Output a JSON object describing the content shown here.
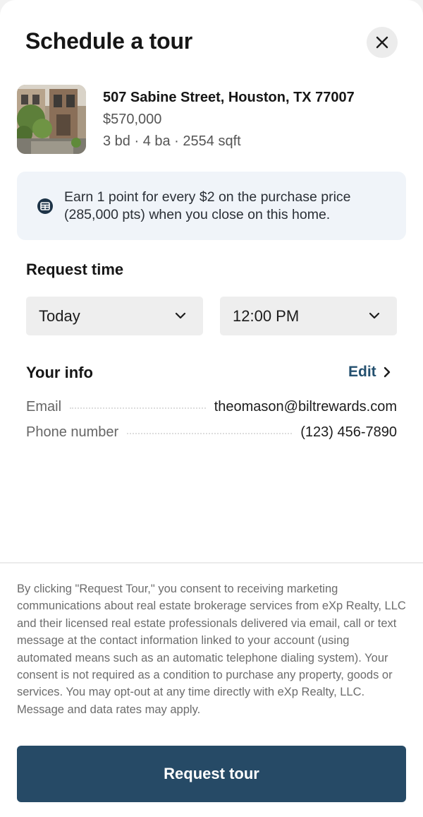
{
  "header": {
    "title": "Schedule a tour",
    "close_icon": "close-icon"
  },
  "property": {
    "address": "507 Sabine Street, Houston, TX 77007",
    "price": "$570,000",
    "details": "3 bd · 4 ba · 2554 sqft"
  },
  "points_banner": {
    "icon": "rewards-card-icon",
    "text": "Earn 1 point for every $2 on the purchase price (285,000 pts) when you close on this home."
  },
  "request_time": {
    "heading": "Request time",
    "day_value": "Today",
    "time_value": "12:00 PM"
  },
  "your_info": {
    "heading": "Your info",
    "edit_label": "Edit",
    "email_label": "Email",
    "email_value": "theomason@biltrewards.com",
    "phone_label": "Phone number",
    "phone_value": "(123) 456-7890"
  },
  "consent_text": "By clicking \"Request Tour,\" you consent to receiving marketing communications about real estate brokerage services from eXp Realty, LLC and their licensed real estate professionals delivered via email, call or text message at the contact information linked to your account (using automated means such as an automatic telephone dialing system). Your consent is not required as a condition to purchase any property, goods or services. You may opt-out at any time directly with eXp Realty, LLC. Message and data rates may apply.",
  "actions": {
    "request_label": "Request tour"
  },
  "colors": {
    "primary_button": "#264a66",
    "link": "#24506f",
    "banner_bg": "#f0f4f9"
  }
}
